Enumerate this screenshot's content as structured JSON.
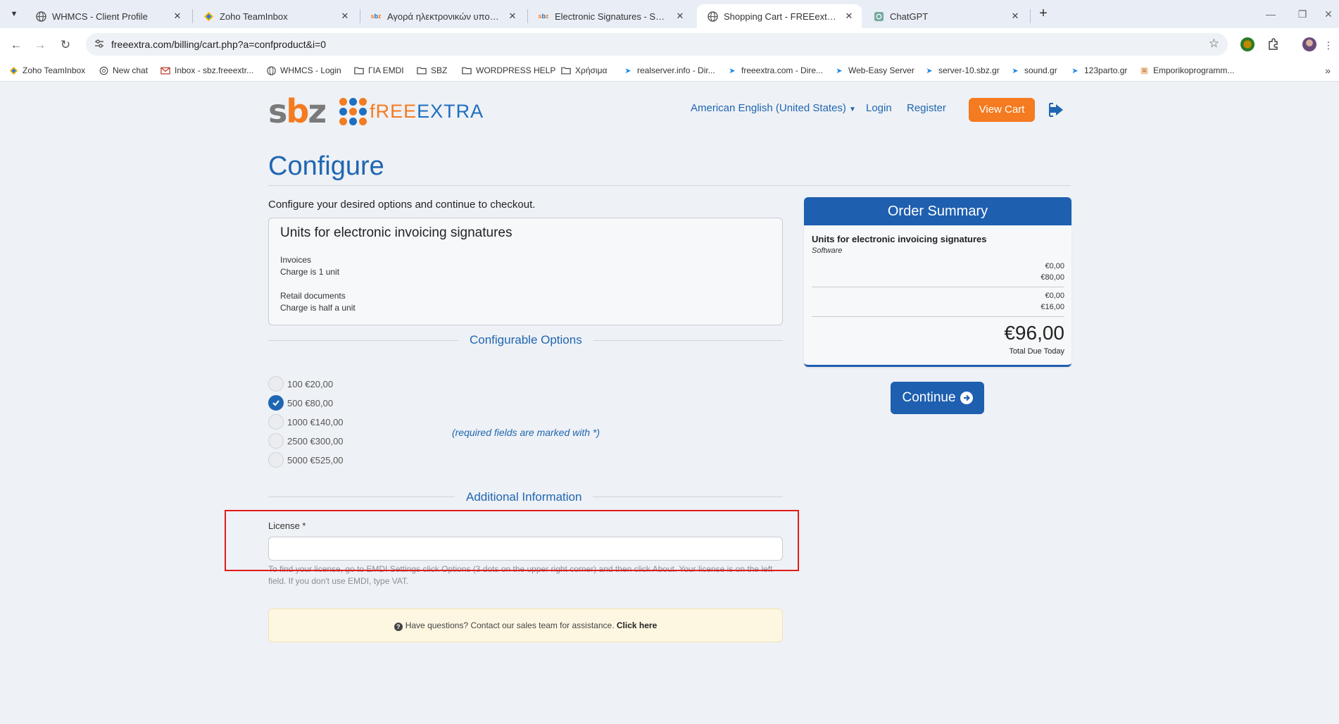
{
  "browser": {
    "tabs": [
      {
        "title": "WHMCS - Client Profile"
      },
      {
        "title": "Zoho TeamInbox"
      },
      {
        "title": "Αγορά ηλεκτρονικών υπογραφών"
      },
      {
        "title": "Electronic Signatures - SBZ Syst"
      },
      {
        "title": "Shopping Cart - FREEextra.com"
      },
      {
        "title": "ChatGPT"
      }
    ],
    "favicon_labels": {
      "sbz": "sbz"
    },
    "url": "freeextra.com/billing/cart.php?a=confproduct&i=0",
    "bookmarks": [
      {
        "label": "Zoho TeamInbox"
      },
      {
        "label": "New chat"
      },
      {
        "label": "Inbox - sbz.freeextr..."
      },
      {
        "label": "WHMCS - Login"
      },
      {
        "label": "ΓΙΑ EMDI"
      },
      {
        "label": "SBZ"
      },
      {
        "label": "WORDPRESS HELP"
      },
      {
        "label": "Χρήσιμα"
      },
      {
        "label": "realserver.info - Dir..."
      },
      {
        "label": "freeextra.com - Dire..."
      },
      {
        "label": "Web-Easy Server"
      },
      {
        "label": "server-10.sbz.gr"
      },
      {
        "label": "sound.gr"
      },
      {
        "label": "123parto.gr"
      },
      {
        "label": "Emporikoprogramm..."
      }
    ]
  },
  "header": {
    "logo_sbz_1": "s",
    "logo_sbz_2": "b",
    "logo_sbz_3": "z",
    "logo_fe_1": "f",
    "logo_fe_2": "REE",
    "logo_fe_3": "EXTRA",
    "language": "American English (United States)",
    "login": "Login",
    "register": "Register",
    "view_cart": "View Cart"
  },
  "page": {
    "title": "Configure",
    "intro": "Configure your desired options and continue to checkout."
  },
  "product": {
    "name": "Units for electronic invoicing signatures",
    "desc": [
      {
        "line1": "Invoices",
        "line2": "Charge is 1 unit"
      },
      {
        "line1": "Retail documents",
        "line2": "Charge is half a unit"
      }
    ]
  },
  "configurable_options": {
    "heading": "Configurable Options",
    "options": [
      {
        "label": "100 €20,00",
        "selected": false
      },
      {
        "label": "500 €80,00",
        "selected": true
      },
      {
        "label": "1000 €140,00",
        "selected": false
      },
      {
        "label": "2500 €300,00",
        "selected": false
      },
      {
        "label": "5000 €525,00",
        "selected": false
      }
    ]
  },
  "additional_info": {
    "heading": "Additional Information",
    "required_note": "(required fields are marked with *)",
    "license_label": "License *",
    "license_value": "",
    "license_help": "To find your license, go to EMDI Settings click Options (3 dots on the upper right corner) and then click About. Your license is on the left field. If you don't use EMDI, type VAT."
  },
  "assistance": {
    "text": "Have questions? Contact our sales team for assistance.",
    "link": "Click here"
  },
  "order_summary": {
    "heading": "Order Summary",
    "product_name": "Units for electronic invoicing signatures",
    "product_group": "Software",
    "amounts": [
      "€0,00",
      "€80,00",
      "€0,00",
      "€16,00"
    ],
    "total": "€96,00",
    "total_label": "Total Due Today"
  },
  "continue_label": "Continue",
  "colors": {
    "brand_blue": "#1f66b2",
    "brand_orange": "#f47b20",
    "highlight_red": "#e01b1b"
  }
}
